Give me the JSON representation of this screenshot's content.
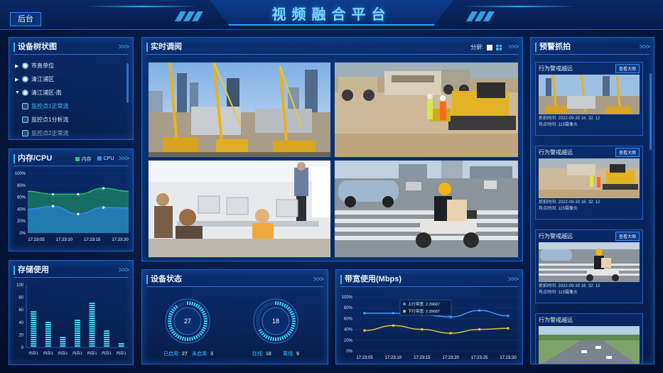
{
  "header": {
    "title": "视频融合平台",
    "back_label": "后台"
  },
  "device_tree": {
    "title": "设备树状图",
    "chevron": ">>>",
    "items": [
      {
        "label": "市直单位",
        "level": 0,
        "expanded": false,
        "type": "org"
      },
      {
        "label": "清江浦区",
        "level": 0,
        "expanded": false,
        "type": "org"
      },
      {
        "label": "清江浦区-南",
        "level": 0,
        "expanded": true,
        "type": "org"
      },
      {
        "label": "监控点1正常流",
        "level": 1,
        "type": "camera",
        "selected": true
      },
      {
        "label": "监控点1分析流",
        "level": 1,
        "type": "camera"
      },
      {
        "label": "监控点2正常流",
        "level": 1,
        "type": "camera",
        "dim": true
      }
    ]
  },
  "mem_cpu": {
    "title": "内存/CPU",
    "chevron": ">>>",
    "legend": [
      {
        "name": "内存",
        "color": "#27c46a"
      },
      {
        "name": "CPU",
        "color": "#2e8bff"
      }
    ],
    "chart_data": {
      "type": "area",
      "x": [
        "17:23:05",
        "17:23:10",
        "17:23:15",
        "17:23:20"
      ],
      "yticks": [
        "100%",
        "80%",
        "60%",
        "40%",
        "20%",
        "0%"
      ],
      "ylim": [
        0,
        100
      ],
      "series": [
        {
          "name": "内存",
          "values": [
            70,
            65,
            65,
            75,
            70
          ]
        },
        {
          "name": "CPU",
          "values": [
            40,
            45,
            32,
            43,
            42
          ]
        }
      ]
    }
  },
  "storage": {
    "title": "存储使用",
    "chevron": ">>>",
    "chart_data": {
      "type": "bar",
      "categories": [
        "内存1",
        "内存1",
        "内存1",
        "内存1",
        "内存1",
        "内存1",
        "内存1"
      ],
      "values": [
        60,
        42,
        20,
        45,
        72,
        30,
        10
      ],
      "yticks": [
        "100",
        "80",
        "60",
        "40",
        "20",
        "0"
      ],
      "ylim": [
        0,
        100
      ]
    }
  },
  "live": {
    "title": "实时调阅",
    "split_label": "分屏:",
    "chevron": ">>>"
  },
  "device_status": {
    "title": "设备状态",
    "chevron": ">>>",
    "gauges": [
      {
        "value": "27",
        "stats": [
          {
            "k": "已启用:",
            "v": "27"
          },
          {
            "k": "未启用:",
            "v": "3"
          }
        ],
        "ratio": 0.9
      },
      {
        "value": "18",
        "stats": [
          {
            "k": "在线:",
            "v": "18"
          },
          {
            "k": "离线:",
            "v": "9"
          }
        ],
        "ratio": 0.67
      }
    ]
  },
  "bandwidth": {
    "title": "带宽使用(Mbps)",
    "chevron": ">>>",
    "tooltip": {
      "up": "上行带宽: 2.39687",
      "down": "下行带宽: 2.39687"
    },
    "chart_data": {
      "type": "line",
      "x": [
        "17:23:05",
        "17:23:10",
        "17:23:15",
        "17:23:20",
        "17:23:25",
        "17:23:30"
      ],
      "yticks": [
        "100%",
        "80%",
        "60%",
        "40%",
        "20%",
        "0%"
      ],
      "ylim": [
        0,
        100
      ],
      "series": [
        {
          "name": "上行带宽",
          "values": [
            70,
            70,
            67,
            63,
            75,
            65
          ]
        },
        {
          "name": "下行带宽",
          "values": [
            38,
            47,
            40,
            33,
            40,
            42
          ]
        }
      ]
    }
  },
  "alarms": {
    "title": "预警抓拍",
    "chevron": ">>>",
    "view_label": "查看大图",
    "items": [
      {
        "title": "行为警戒越远",
        "time": "抓拍时间: 2022-09-30 16: 32: 12",
        "loc": "布点时间: 115摄像头",
        "scene": "construction"
      },
      {
        "title": "行为警戒越远",
        "time": "抓拍时间: 2022-09-30 16: 32: 12",
        "loc": "布点时间: 115摄像头",
        "scene": "site"
      },
      {
        "title": "行为警戒越远",
        "time": "抓拍时间: 2022-09-30 16: 32: 12",
        "loc": "布点时间: 115摄像头",
        "scene": "street"
      },
      {
        "title": "行为警戒越远",
        "time": "",
        "loc": "",
        "scene": "highway"
      }
    ]
  }
}
